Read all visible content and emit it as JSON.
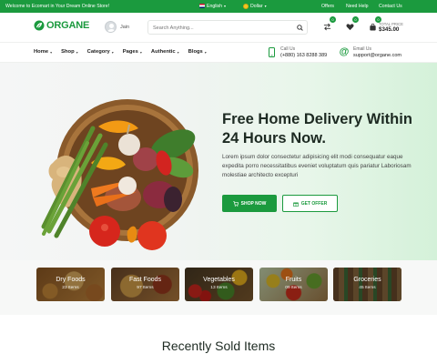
{
  "topbar": {
    "welcome": "Welcome to Ecomart in Your Dream Online Store!",
    "language": "English",
    "currency": "Dollar",
    "links": [
      "Offers",
      "Need Help",
      "Contact Us"
    ]
  },
  "header": {
    "logo": "ORGANE",
    "user_name": "Jain",
    "search_placeholder": "Search Anything...",
    "compare_count": "0",
    "wishlist_count": "0",
    "cart_count": "0",
    "total_label": "TOTAL PRICE",
    "total_value": "$345.00"
  },
  "nav": {
    "items": [
      "Home",
      "Shop",
      "Category",
      "Pages",
      "Authentic",
      "Blogs"
    ],
    "call_label": "Call Us",
    "call_value": "(+880) 163 8288 389",
    "email_label": "Email Us",
    "email_value": "support@organe.com"
  },
  "hero": {
    "title": "Free Home Delivery Within 24 Hours Now.",
    "text": "Lorem ipsum dolor consectetur adipisicing elit modi consequatur eaque expedita porro necessitatibus eveniet voluptatum quis pariatur Laboriosam molestiae architecto excepturi",
    "shop_label": "SHOP NOW",
    "offer_label": "GET OFFER"
  },
  "categories": [
    {
      "name": "Dry Foods",
      "count": "23 Items"
    },
    {
      "name": "Fast Foods",
      "count": "97 Items"
    },
    {
      "name": "Vegetables",
      "count": "13 Items"
    },
    {
      "name": "Fruits",
      "count": "09 Items"
    },
    {
      "name": "Groceries",
      "count": "45 Items"
    }
  ],
  "section_title": "Recently Sold Items",
  "colors": {
    "primary": "#1b9a3e",
    "text": "#1d2a22"
  }
}
